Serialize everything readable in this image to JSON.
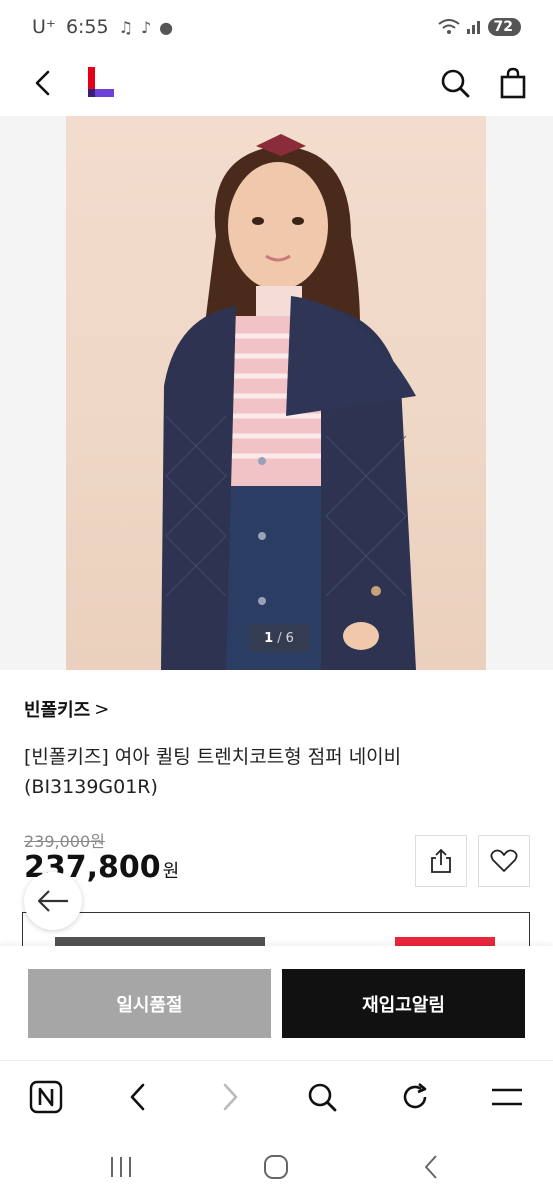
{
  "status_bar": {
    "carrier": "U⁺",
    "time": "6:55",
    "battery": "72"
  },
  "header": {
    "back_icon": "chevron-left-icon",
    "logo_icon": "lotte-l-logo",
    "search_icon": "search-icon",
    "cart_icon": "shopping-bag-icon"
  },
  "gallery": {
    "current": "1",
    "separator": "/",
    "total": "6"
  },
  "product": {
    "brand": "빈폴키즈",
    "brand_chevron": ">",
    "title": "[빈폴키즈] 여아 퀼팅 트렌치코트형 점퍼 네이비 (BI3139G01R)",
    "original_price": "239,000원",
    "sale_price": "237,800",
    "currency": "원"
  },
  "actions": {
    "share_icon": "share-icon",
    "wish_icon": "heart-icon",
    "soldout_label": "일시품절",
    "restock_label": "재입고알림"
  },
  "browser_nav": {
    "icons": [
      "naver-n-icon",
      "back-icon",
      "forward-icon",
      "search-icon",
      "refresh-icon",
      "menu-icon"
    ]
  },
  "android_nav": {
    "icons": [
      "recents-icon",
      "home-icon",
      "back-icon"
    ]
  },
  "colors": {
    "primary_button": "#111111",
    "disabled_button": "#a6a6a6",
    "logo_red": "#e50019",
    "logo_purple": "#6b3fd8"
  }
}
